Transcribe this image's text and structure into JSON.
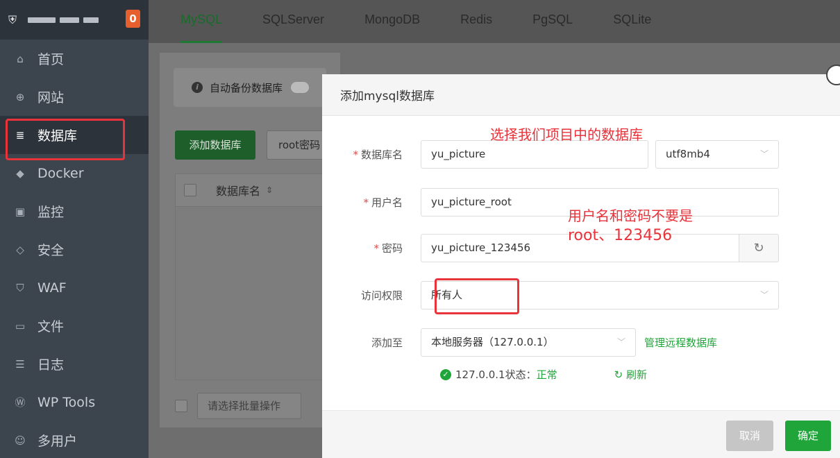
{
  "sidebar": {
    "badge": "0",
    "items": [
      {
        "label": "首页",
        "icon": "home-icon"
      },
      {
        "label": "网站",
        "icon": "globe-icon"
      },
      {
        "label": "数据库",
        "icon": "database-icon"
      },
      {
        "label": "Docker",
        "icon": "docker-icon"
      },
      {
        "label": "监控",
        "icon": "monitor-icon"
      },
      {
        "label": "安全",
        "icon": "shield-icon"
      },
      {
        "label": "WAF",
        "icon": "waf-icon"
      },
      {
        "label": "文件",
        "icon": "folder-icon"
      },
      {
        "label": "日志",
        "icon": "log-icon"
      },
      {
        "label": "WP Tools",
        "icon": "wordpress-icon"
      },
      {
        "label": "多用户",
        "icon": "users-icon"
      }
    ],
    "active": "数据库"
  },
  "tabs": [
    "MySQL",
    "SQLServer",
    "MongoDB",
    "Redis",
    "PgSQL",
    "SQLite"
  ],
  "active_tab": "MySQL",
  "background": {
    "auto_backup_label": "自动备份数据库",
    "add_db_button": "添加数据库",
    "root_pw_button": "root密码",
    "table_col_name": "数据库名",
    "bulk_placeholder": "请选择批量操作"
  },
  "modal": {
    "title": "添加mysql数据库",
    "db_name_label": "数据库名",
    "db_name_value": "yu_picture",
    "charset_value": "utf8mb4",
    "user_label": "用户名",
    "user_value": "yu_picture_root",
    "password_label": "密码",
    "password_value": "yu_picture_123456",
    "access_label": "访问权限",
    "access_value": "所有人",
    "add_to_label": "添加至",
    "add_to_value": "本地服务器（127.0.0.1）",
    "manage_remote_link": "管理远程数据库",
    "status_prefix": "127.0.0.1状态：",
    "status_value": "正常",
    "refresh_link": "刷新",
    "cancel_button": "取消",
    "confirm_button": "确定"
  },
  "annotations": {
    "note1": "选择我们项目中的数据库",
    "note2_line1": "用户名和密码不要是",
    "note2_line2": "root、123456"
  },
  "colors": {
    "accent": "#20a53a",
    "annotation": "#e8333a",
    "badge": "#e65f2c"
  }
}
